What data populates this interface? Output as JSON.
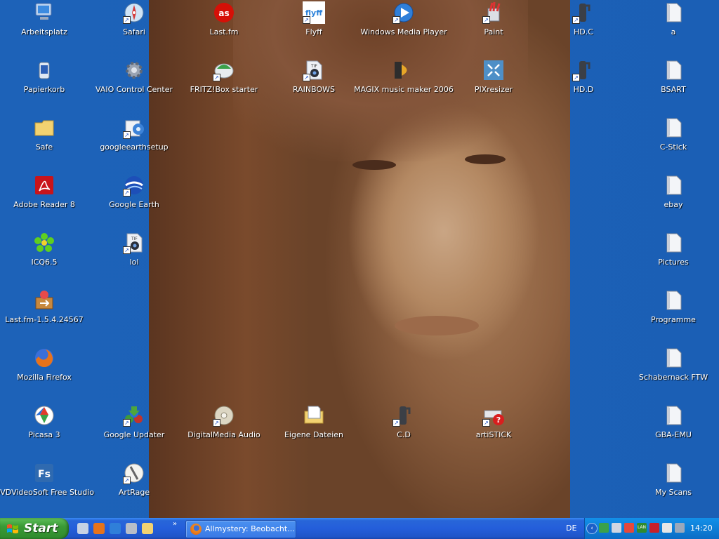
{
  "desktop": {
    "icons": [
      {
        "label": "Arbeitsplatz",
        "icon": "my-computer-icon"
      },
      {
        "label": "Papierkorb",
        "icon": "recycle-bin-icon"
      },
      {
        "label": "Safe",
        "icon": "folder-icon"
      },
      {
        "label": "Adobe Reader 8",
        "icon": "adobe-reader-icon"
      },
      {
        "label": "ICQ6.5",
        "icon": "icq-flower-icon"
      },
      {
        "label": "Last.fm-1.5.4.24567",
        "icon": "installer-icon"
      },
      {
        "label": "Mozilla Firefox",
        "icon": "firefox-icon"
      },
      {
        "label": "Picasa 3",
        "icon": "picasa-icon"
      },
      {
        "label": "DVDVideoSoft Free Studio",
        "icon": "free-studio-icon"
      },
      {
        "label": "Safari",
        "icon": "safari-compass-icon"
      },
      {
        "label": "VAIO Control Center",
        "icon": "gear-icon"
      },
      {
        "label": "googleearthsetup",
        "icon": "setup-icon"
      },
      {
        "label": "Google Earth",
        "icon": "google-earth-icon"
      },
      {
        "label": "lol",
        "icon": "tif-file-icon"
      },
      {
        "label": "Google Updater",
        "icon": "google-updater-icon"
      },
      {
        "label": "ArtRage",
        "icon": "artrage-icon"
      },
      {
        "label": "Last.fm",
        "icon": "lastfm-icon"
      },
      {
        "label": "FRITZ!Box starter",
        "icon": "fritzbox-icon"
      },
      {
        "label": "DigitalMedia Audio",
        "icon": "cd-icon"
      },
      {
        "label": "Flyff",
        "icon": "flyff-icon"
      },
      {
        "label": "RAINBOWS",
        "icon": "tif-file-icon"
      },
      {
        "label": "Eigene Dateien",
        "icon": "my-documents-icon"
      },
      {
        "label": "Windows Media Player",
        "icon": "media-player-icon"
      },
      {
        "label": "MAGIX music maker 2006",
        "icon": "speaker-icon"
      },
      {
        "label": "C.D",
        "icon": "drive-shortcut-icon"
      },
      {
        "label": "Paint",
        "icon": "paint-icon"
      },
      {
        "label": "PIXresizer",
        "icon": "pixresizer-icon"
      },
      {
        "label": "artiSTICK",
        "icon": "help-device-icon"
      },
      {
        "label": "HD.C",
        "icon": "drive-shortcut-icon"
      },
      {
        "label": "HD.D",
        "icon": "drive-shortcut-icon"
      },
      {
        "label": "a",
        "icon": "file-icon"
      },
      {
        "label": "BSART",
        "icon": "file-icon"
      },
      {
        "label": "C-Stick",
        "icon": "file-icon"
      },
      {
        "label": "ebay",
        "icon": "file-icon"
      },
      {
        "label": "Pictures",
        "icon": "file-icon"
      },
      {
        "label": "Programme",
        "icon": "file-icon"
      },
      {
        "label": "Schabernack FTW",
        "icon": "file-icon"
      },
      {
        "label": "GBA-EMU",
        "icon": "file-icon"
      },
      {
        "label": "My Scans",
        "icon": "file-icon"
      }
    ]
  },
  "taskbar": {
    "start_label": "Start",
    "quick_launch": [
      "show-desktop-icon",
      "firefox-icon",
      "media-player-icon",
      "program-icon",
      "folder-icon"
    ],
    "chevron": "»",
    "task_title": "Allmystery: Beobacht...",
    "language": "DE",
    "tray_icons": [
      "network-icon",
      "monitor-icon",
      "pinwheel-icon",
      "lan-icon",
      "antivirus-icon",
      "printer-icon",
      "speaker-icon"
    ],
    "lan_text": "LAN",
    "clock": "14:20"
  },
  "colors": {
    "desktop": "#1b5fb5",
    "taskbar": "#245edb",
    "start": "#3a9a36",
    "tray": "#0f7fd7"
  }
}
